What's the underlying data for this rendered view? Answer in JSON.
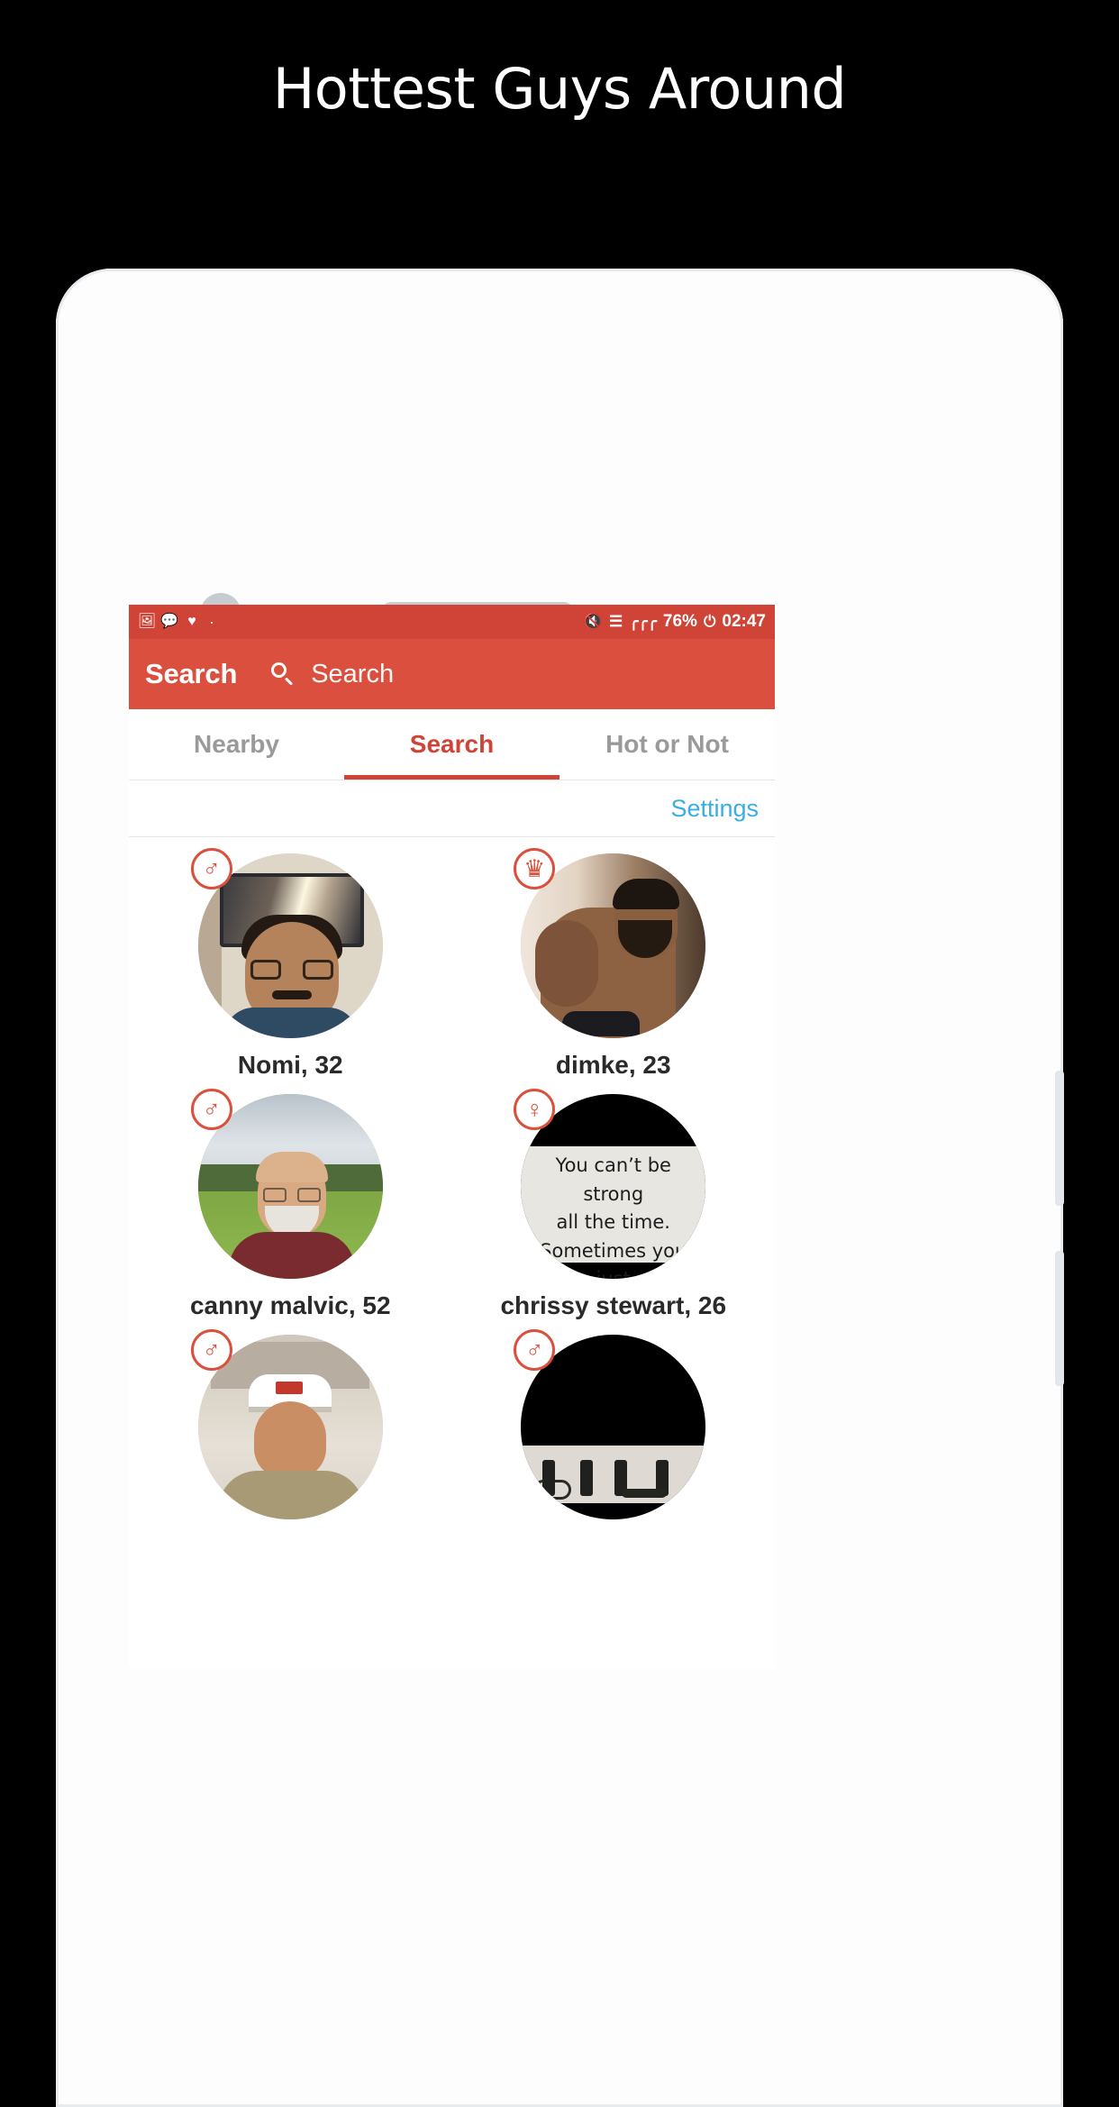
{
  "headline": "Hottest Guys Around",
  "status_bar": {
    "icons": [
      "image-icon",
      "chat-icon",
      "heart-icon"
    ],
    "separator": "·",
    "mute_icon": "mute-icon",
    "wifi_icon": "wifi-icon",
    "signal_icon": "signal-icon",
    "battery_percent": "76%",
    "battery_icon": "battery-charging-icon",
    "time": "02:47"
  },
  "app_bar": {
    "title": "Search",
    "search_icon": "search-icon",
    "search_placeholder": "Search",
    "background": "#da4f3d"
  },
  "tabs": [
    {
      "label": "Nearby",
      "active": false
    },
    {
      "label": "Search",
      "active": true
    },
    {
      "label": "Hot or Not",
      "active": false
    }
  ],
  "toolbar": {
    "settings_label": "Settings",
    "settings_color": "#3aaee0"
  },
  "accent_color": "#cf4436",
  "results": [
    {
      "name": "Nomi, 32",
      "badge_icon": "male-symbol-icon",
      "badge_glyph": "♂"
    },
    {
      "name": "dimke, 23",
      "badge_icon": "hot-or-not-icon",
      "badge_glyph": "♛"
    },
    {
      "name": "canny malvic, 52",
      "badge_icon": "male-symbol-icon",
      "badge_glyph": "♂"
    },
    {
      "name": "chrissy stewart, 26",
      "badge_icon": "female-symbol-icon",
      "badge_glyph": "♀"
    },
    {
      "name": "",
      "badge_icon": "male-symbol-icon",
      "badge_glyph": "♂"
    },
    {
      "name": "",
      "badge_icon": "male-symbol-icon",
      "badge_glyph": "♂"
    }
  ],
  "photo_quote": "You can’t be strong\nall the time.\nSometimes you just\nneed to be alone and\nlet your tears out."
}
